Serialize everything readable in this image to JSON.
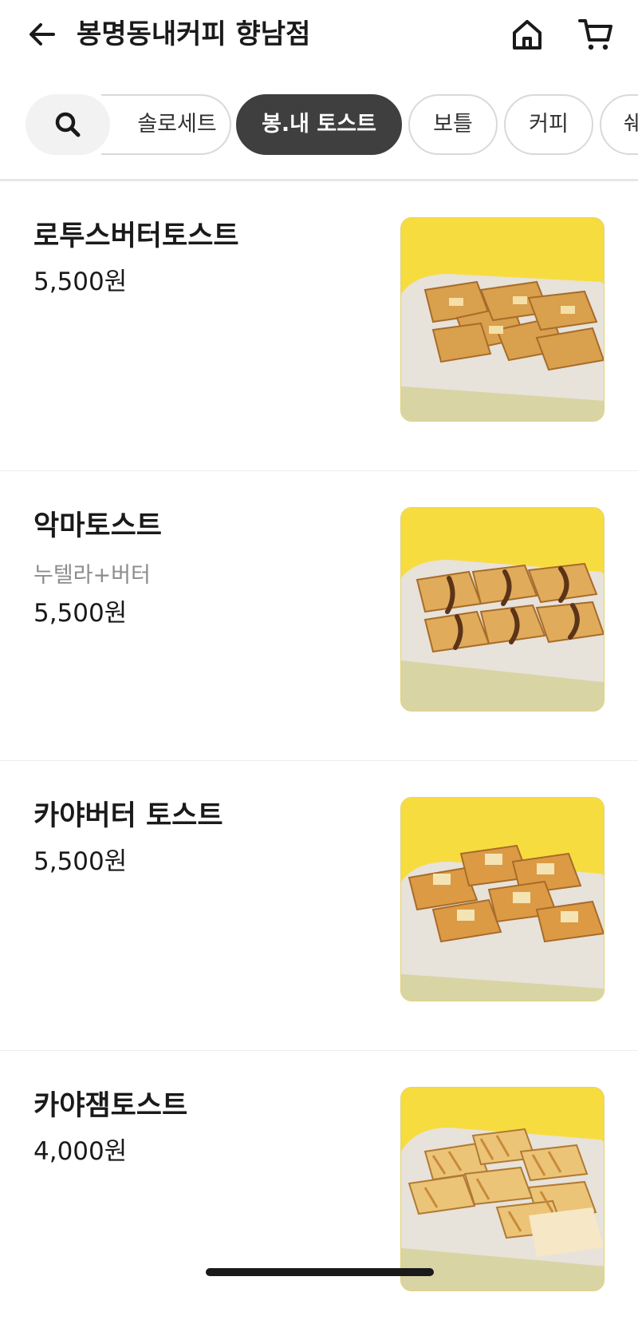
{
  "header": {
    "title": "봉명동내커피 향남점",
    "back_icon": "arrow-left-icon",
    "home_icon": "home-icon",
    "cart_icon": "cart-icon"
  },
  "categories": {
    "search_icon": "search-icon",
    "items": [
      {
        "label": "솔로세트",
        "active": false
      },
      {
        "label": "봉.내 토스트",
        "active": true
      },
      {
        "label": "보틀",
        "active": false
      },
      {
        "label": "커피",
        "active": false
      },
      {
        "label": "쉐",
        "active": false
      }
    ]
  },
  "menu": [
    {
      "name": "로투스버터토스트",
      "description": "",
      "price": "5,500원"
    },
    {
      "name": "악마토스트",
      "description": "누텔라+버터",
      "price": "5,500원"
    },
    {
      "name": "카야버터 토스트",
      "description": "",
      "price": "5,500원"
    },
    {
      "name": "카야잼토스트",
      "description": "",
      "price": "4,000원"
    }
  ],
  "colors": {
    "active_chip": "#3f3f3f",
    "photo_background": "#f7dc3f",
    "text_primary": "#1a1a1a",
    "text_secondary": "#8c8c8c"
  }
}
